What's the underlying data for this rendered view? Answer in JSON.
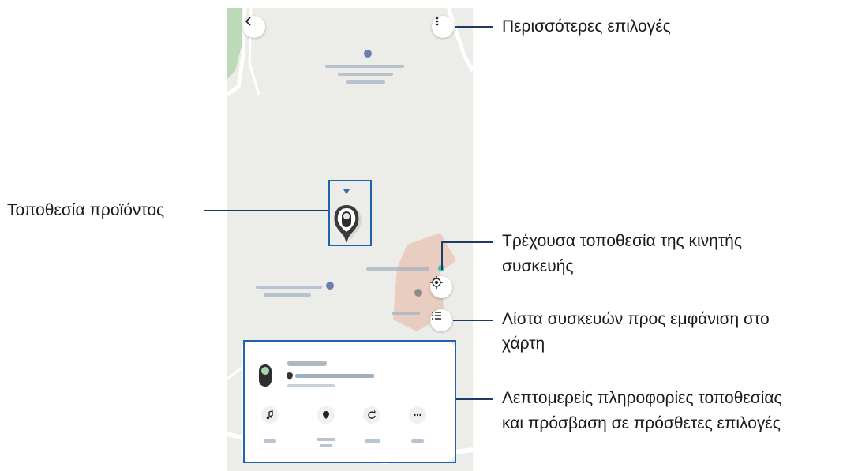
{
  "callouts": {
    "more_options": "Περισσότερες επιλογές",
    "product_location": "Τοποθεσία προϊόντος",
    "current_location_line1": "Τρέχουσα τοποθεσία της κινητής",
    "current_location_line2": "συσκευής",
    "device_list_line1": "Λίστα συσκευών προς εμφάνιση στο",
    "device_list_line2": "χάρτη",
    "details_line1": "Λεπτομερείς πληροφορίες τοποθεσίας",
    "details_line2": "και πρόσβαση σε πρόσθετες επιλογές"
  },
  "icons": {
    "back": "chevron-left-icon",
    "more": "vertical-dots-icon",
    "locate": "target-icon",
    "list": "list-icon",
    "ring": "music-note-icon",
    "location_history": "pin-icon",
    "refresh": "refresh-icon",
    "more_actions": "horizontal-dots-icon"
  },
  "colors": {
    "callout_line": "#1f3a64",
    "selection_box": "#1f63b0",
    "map_background": "#ecece9"
  }
}
